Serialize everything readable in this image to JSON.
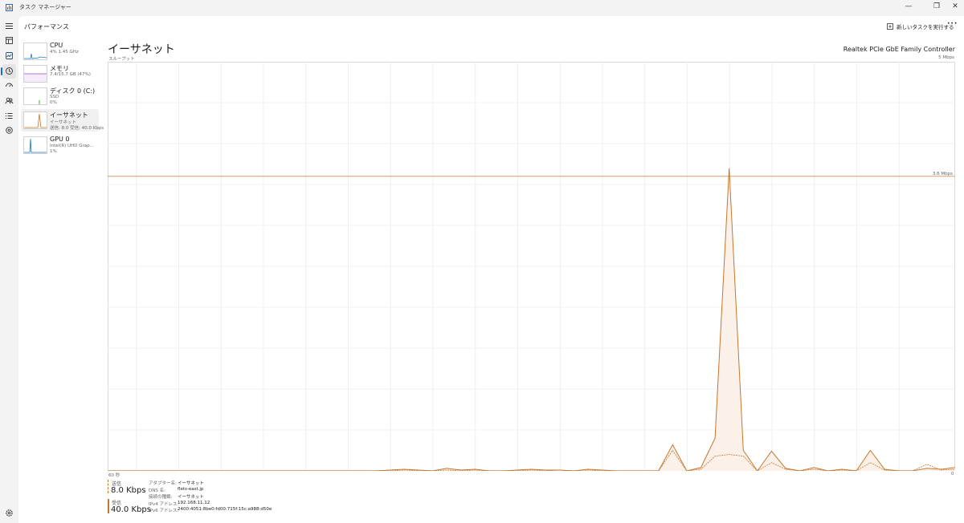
{
  "window": {
    "title": "タスク マネージャー",
    "minimize_glyph": "—",
    "restore_glyph": "❐",
    "close_glyph": "✕"
  },
  "header": {
    "title": "パフォーマンス",
    "run_task_label": "新しいタスクを実行する",
    "more_label": "···"
  },
  "rail": {
    "icons": [
      "menu-icon",
      "processes-icon",
      "performance-icon",
      "app-history-icon",
      "startup-apps-icon",
      "users-icon",
      "details-icon",
      "services-icon",
      "settings-icon"
    ]
  },
  "resources": [
    {
      "name": "CPU",
      "sub1": "4%  1.45 GHz",
      "sub2": "",
      "color": "#1a78c8"
    },
    {
      "name": "メモリ",
      "sub1": "7.4/15.7 GB (47%)",
      "sub2": "",
      "color": "#9a4ec8"
    },
    {
      "name": "ディスク 0 (C:)",
      "sub1": "SSD",
      "sub2": "0%",
      "color": "#4fa035"
    },
    {
      "name": "イーサネット",
      "sub1": "イーサネット",
      "sub2": "送信: 8.0 受信: 40.0 Kbps",
      "color": "#c8762e"
    },
    {
      "name": "GPU 0",
      "sub1": "Intel(R) UHD Grap...",
      "sub2": "1%",
      "color": "#1a78c8"
    }
  ],
  "main": {
    "title": "イーサネット",
    "adapter": "Realtek PCIe GbE Family Controller",
    "throughput_label": "スループット",
    "max_label": "5 Mbps",
    "mid_label": "3.6 Mbps",
    "time_label": "60 秒",
    "zero_label": "0"
  },
  "stats": {
    "send_label": "送信",
    "send_value": "8.0 Kbps",
    "recv_label": "受信",
    "recv_value": "40.0 Kbps"
  },
  "properties": [
    {
      "key": "アダプター名:",
      "value": "イーサネット"
    },
    {
      "key": "DNS 名:",
      "value": "flets-east.jp"
    },
    {
      "key": "接続の種類:",
      "value": "イーサネット"
    },
    {
      "key": "IPv4 アドレス:",
      "value": "192.168.11.12"
    },
    {
      "key": "IPv6 アドレス:",
      "value": "2400:4051:8be0:fd00:715f:15c:a988:d50e"
    }
  ],
  "colors": {
    "accent": "#c8762e",
    "fill": "#fbf1e8",
    "grid": "#ececec"
  },
  "chart_data": {
    "type": "area",
    "ylim": [
      0,
      5
    ],
    "y_unit": "Mbps",
    "xlim": [
      60,
      0
    ],
    "x_unit": "秒",
    "marker_line": 3.6,
    "series": [
      {
        "name": "受信",
        "values": [
          0,
          0,
          0,
          0,
          0,
          0,
          0,
          0,
          0,
          0,
          0,
          0,
          0,
          0,
          0,
          0,
          0,
          0,
          0,
          0,
          0.01,
          0.02,
          0.01,
          0,
          0.03,
          0.01,
          0.02,
          0,
          0,
          0.01,
          0.02,
          0.01,
          0.01,
          0,
          0.02,
          0.01,
          0,
          0,
          0,
          0,
          0.32,
          0,
          0.04,
          0.4,
          3.7,
          0.25,
          0,
          0.24,
          0.03,
          0,
          0.04,
          0,
          0.02,
          0,
          0.25,
          0.02,
          0,
          0,
          0.03,
          0.02,
          0.04
        ]
      },
      {
        "name": "送信",
        "values": [
          0,
          0,
          0,
          0,
          0,
          0,
          0,
          0,
          0,
          0,
          0,
          0,
          0,
          0,
          0,
          0,
          0,
          0,
          0,
          0,
          0,
          0.01,
          0,
          0,
          0.01,
          0,
          0.01,
          0,
          0,
          0,
          0.01,
          0,
          0.01,
          0,
          0.01,
          0,
          0,
          0,
          0,
          0,
          0.25,
          0,
          0.02,
          0.18,
          0.2,
          0.18,
          0,
          0.1,
          0.02,
          0,
          0.02,
          0,
          0.01,
          0,
          0.1,
          0.01,
          0,
          0,
          0.08,
          0.01,
          0.02
        ]
      }
    ]
  }
}
